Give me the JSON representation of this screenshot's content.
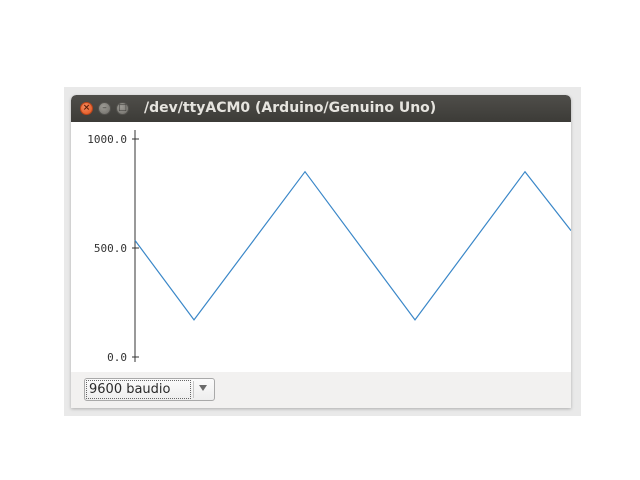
{
  "window": {
    "title": "/dev/ttyACM0 (Arduino/Genuino Uno)",
    "buttons": [
      {
        "name": "close",
        "glyph": "×"
      },
      {
        "name": "minimize",
        "glyph": "–"
      },
      {
        "name": "maximize",
        "glyph": "□"
      }
    ]
  },
  "baud": {
    "selected": "9600 baudio"
  },
  "colors": {
    "titlebar": "#3c3b37",
    "close_button": "#e0531d",
    "trace": "#3a87c8",
    "axis": "#333333"
  },
  "chart_data": {
    "type": "line",
    "title": "",
    "xlabel": "",
    "ylabel": "",
    "ylim": [
      0,
      1000
    ],
    "y_ticks": [
      "1000.0",
      "500.0",
      "0.0"
    ],
    "y_tick_values": [
      1000,
      500,
      0
    ],
    "grid": false,
    "series": [
      {
        "x": [
          0,
          59,
          170,
          280,
          390,
          436
        ],
        "values": [
          535,
          170,
          850,
          170,
          850,
          580
        ]
      }
    ]
  }
}
